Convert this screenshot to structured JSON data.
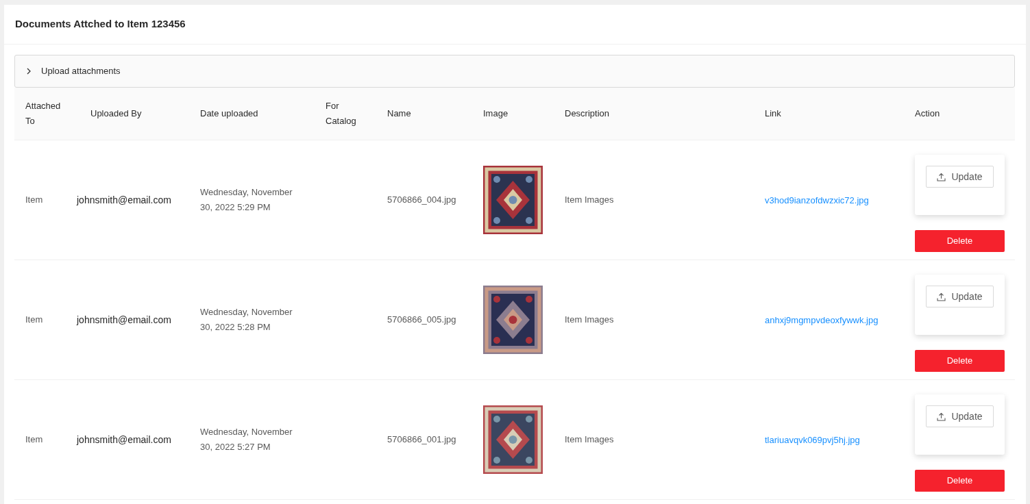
{
  "title": "Documents Attched to Item 123456",
  "upload_panel": {
    "label": "Upload attachments",
    "expanded": false
  },
  "columns": [
    "Attached To",
    "Uploaded By",
    "Date uploaded",
    "For Catalog",
    "Name",
    "Image",
    "Description",
    "Link",
    "Action"
  ],
  "rows": [
    {
      "attached_to": "Item",
      "uploaded_by": "johnsmith@email.com",
      "date": "Wednesday, November 30, 2022 5:29 PM",
      "name": "5706866_004.jpg",
      "description": "Item Images",
      "link": "v3hod9ianzofdwzxic72.jpg",
      "update": "Update",
      "delete": "Delete"
    },
    {
      "attached_to": "Item",
      "uploaded_by": "johnsmith@email.com",
      "date": "Wednesday, November 30, 2022 5:28 PM",
      "name": "5706866_005.jpg",
      "description": "Item Images",
      "link": "anhxj9mgmpvdeoxfywwk.jpg",
      "update": "Update",
      "delete": "Delete"
    },
    {
      "attached_to": "Item",
      "uploaded_by": "johnsmith@email.com",
      "date": "Wednesday, November 30, 2022 5:27 PM",
      "name": "5706866_001.jpg",
      "description": "Item Images",
      "link": "tlariuavqvk069pvj5hj.jpg",
      "update": "Update",
      "delete": "Delete"
    }
  ]
}
